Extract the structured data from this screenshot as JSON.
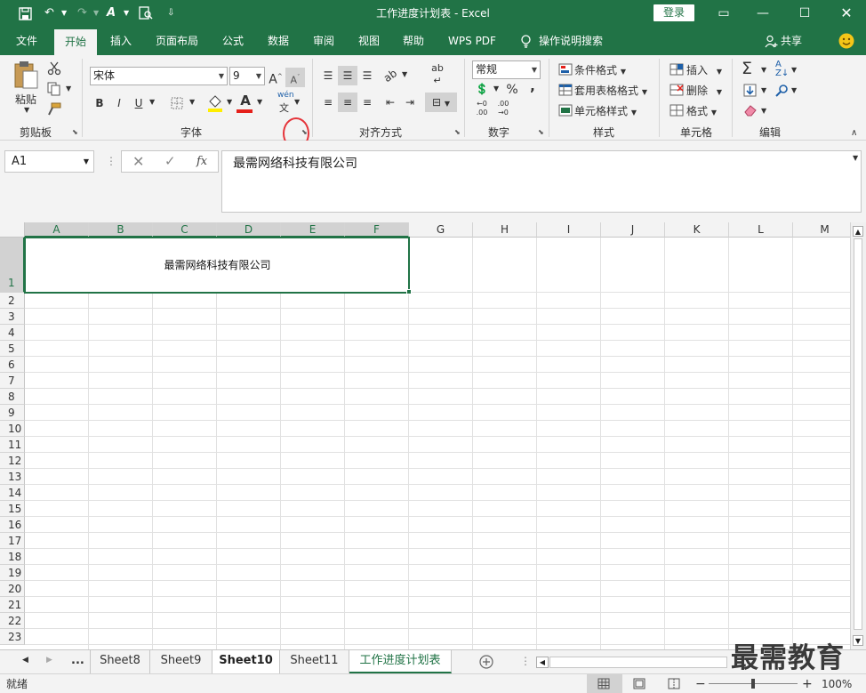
{
  "window": {
    "title": "工作进度计划表  -  Excel",
    "login_label": "登录"
  },
  "tabs": [
    "文件",
    "开始",
    "插入",
    "页面布局",
    "公式",
    "数据",
    "审阅",
    "视图",
    "帮助",
    "WPS PDF"
  ],
  "tell_me": "操作说明搜索",
  "share_label": "共享",
  "ribbon": {
    "clipboard": {
      "paste_label": "粘贴",
      "group_label": "剪贴板"
    },
    "font": {
      "font_name": "宋体",
      "font_size": "9",
      "bold": "B",
      "italic": "I",
      "underline": "U",
      "group_label": "字体",
      "phonetic_top": "wén",
      "phonetic_bottom": "文"
    },
    "alignment": {
      "group_label": "对齐方式"
    },
    "number": {
      "format": "常规",
      "percent": "%",
      "comma": ",",
      "group_label": "数字"
    },
    "styles": {
      "conditional": "条件格式",
      "table": "套用表格格式",
      "cell": "单元格样式",
      "group_label": "样式"
    },
    "cells": {
      "insert": "插入",
      "delete": "删除",
      "format": "格式",
      "group_label": "单元格"
    },
    "editing": {
      "group_label": "编辑"
    }
  },
  "formula_bar": {
    "name_box": "A1",
    "fx": "fx",
    "content": "最需网络科技有限公司"
  },
  "grid": {
    "columns": [
      "A",
      "B",
      "C",
      "D",
      "E",
      "F",
      "G",
      "H",
      "I",
      "J",
      "K",
      "L",
      "M"
    ],
    "rows": [
      "1",
      "2",
      "3",
      "4",
      "5",
      "6",
      "7",
      "8",
      "9",
      "10",
      "11",
      "12",
      "13",
      "14",
      "15",
      "16",
      "17",
      "18",
      "19",
      "20",
      "21",
      "22",
      "23"
    ],
    "cell_A1": "最需网络科技有限公司"
  },
  "sheets": {
    "ellipsis": "...",
    "tabs": [
      "Sheet8",
      "Sheet9",
      "Sheet10",
      "Sheet11",
      "工作进度计划表"
    ],
    "active": "工作进度计划表"
  },
  "status": {
    "ready": "就绪",
    "zoom": "100%"
  },
  "watermark": "最需教育",
  "colors": {
    "accent": "#217346",
    "highlight": "#e5343a",
    "font_color_bar": "#e5201a",
    "fill_color_bar": "#ffee00"
  }
}
